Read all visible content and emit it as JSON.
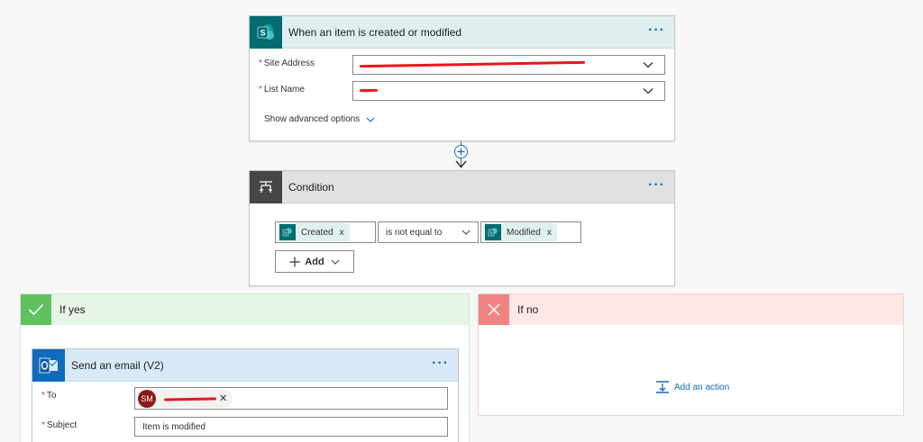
{
  "trigger": {
    "title": "When an item is created or modified",
    "more": "···",
    "site_address_label": "Site Address",
    "list_name_label": "List Name",
    "required_mark": "*",
    "advanced_link": "Show advanced options"
  },
  "condition": {
    "title": "Condition",
    "more": "···",
    "left_token": "Created",
    "operator": "is not equal to",
    "right_token": "Modified",
    "remove_mark": "x",
    "add_label": "Add"
  },
  "if_yes": {
    "title": "If yes"
  },
  "if_no": {
    "title": "If no",
    "add_action": "Add an action"
  },
  "email": {
    "title": "Send an email (V2)",
    "more": "···",
    "to_label": "To",
    "subject_label": "Subject",
    "subject_value": "Item is modified",
    "avatar_initials": "SM",
    "remove_mark": "✕"
  },
  "colors": {
    "sharepoint": "#036c70",
    "condition_tile": "#484644",
    "yes_tile": "#5fc25f",
    "no_tile": "#f08481",
    "outlook_tile": "#0f6cbd",
    "accent": "#0f6cbd"
  }
}
